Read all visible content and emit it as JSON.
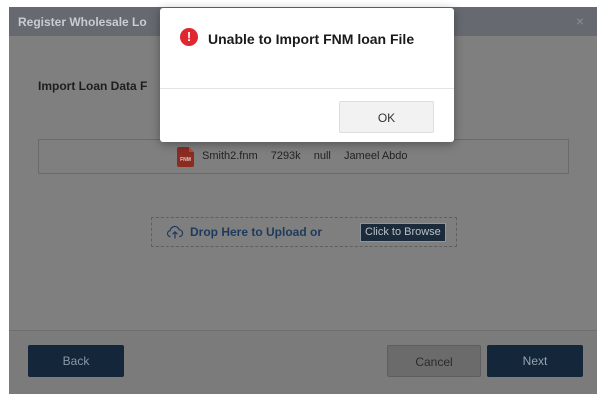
{
  "modal": {
    "title": "Register Wholesale Lo",
    "close_glyph": "×",
    "subtitle": "Import Loan Data F",
    "file": {
      "icon_label": "FNM",
      "name": "Smith2.fnm",
      "size": "7293k",
      "status": "null",
      "owner": "Jameel Abdo"
    },
    "drop_zone": {
      "label": "Drop Here to Upload or",
      "browse_label": "Click to Browse"
    },
    "footer": {
      "back_label": "Back",
      "cancel_label": "Cancel",
      "next_label": "Next"
    }
  },
  "alert": {
    "icon_glyph": "!",
    "title": "Unable to Import FNM loan File",
    "ok_label": "OK"
  },
  "icons": {
    "close": "close-icon",
    "error": "error-icon",
    "file": "fnm-file-icon",
    "upload": "cloud-upload-icon"
  },
  "colors": {
    "error": "#e0262e",
    "primary_button": "#14263a",
    "link": "#1d3a5c"
  }
}
